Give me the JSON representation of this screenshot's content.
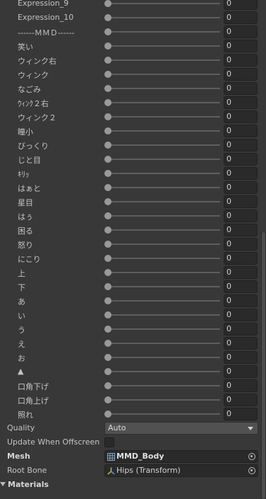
{
  "blendshapes": [
    {
      "label": "Expression_9",
      "value": "0"
    },
    {
      "label": "Expression_10",
      "value": "0"
    },
    {
      "label": "------ＭＭＤ------",
      "value": "0"
    },
    {
      "label": "笑い",
      "value": "0"
    },
    {
      "label": "ウィンク右",
      "value": "0"
    },
    {
      "label": "ウィンク",
      "value": "0"
    },
    {
      "label": "なごみ",
      "value": "0"
    },
    {
      "label": "ｳｨﾝｸ２右",
      "value": "0"
    },
    {
      "label": "ウィンク２",
      "value": "0"
    },
    {
      "label": "瞳小",
      "value": "0"
    },
    {
      "label": "びっくり",
      "value": "0"
    },
    {
      "label": "じと目",
      "value": "0"
    },
    {
      "label": "ｷﾘｯ",
      "value": "0"
    },
    {
      "label": "はぁと",
      "value": "0"
    },
    {
      "label": "星目",
      "value": "0"
    },
    {
      "label": "はぅ",
      "value": "0"
    },
    {
      "label": "困る",
      "value": "0"
    },
    {
      "label": "怒り",
      "value": "0"
    },
    {
      "label": "にこり",
      "value": "0"
    },
    {
      "label": "上",
      "value": "0"
    },
    {
      "label": "下",
      "value": "0"
    },
    {
      "label": "あ",
      "value": "0"
    },
    {
      "label": "い",
      "value": "0"
    },
    {
      "label": "う",
      "value": "0"
    },
    {
      "label": "え",
      "value": "0"
    },
    {
      "label": "お",
      "value": "0"
    },
    {
      "label": "▲",
      "value": "0"
    },
    {
      "label": "口角下げ",
      "value": "0"
    },
    {
      "label": "口角上げ",
      "value": "0"
    },
    {
      "label": "照れ",
      "value": "0"
    }
  ],
  "slider_level": 0,
  "quality": {
    "label": "Quality",
    "value": "Auto"
  },
  "update_offscreen": {
    "label": "Update When Offscreen",
    "checked": false
  },
  "mesh": {
    "label": "Mesh",
    "value": "MMD_Body",
    "icon": "mesh-icon"
  },
  "root_bone": {
    "label": "Root Bone",
    "value": "Hips (Transform)",
    "icon": "transform-icon"
  },
  "materials": {
    "label": "Materials"
  },
  "colors": {
    "panel_bg": "#383838",
    "field_bg": "#2a2a2a",
    "dropdown_bg": "#515151",
    "text": "#c4c4c4",
    "slider_thumb": "#999999",
    "slider_track": "#5e5e5e"
  }
}
